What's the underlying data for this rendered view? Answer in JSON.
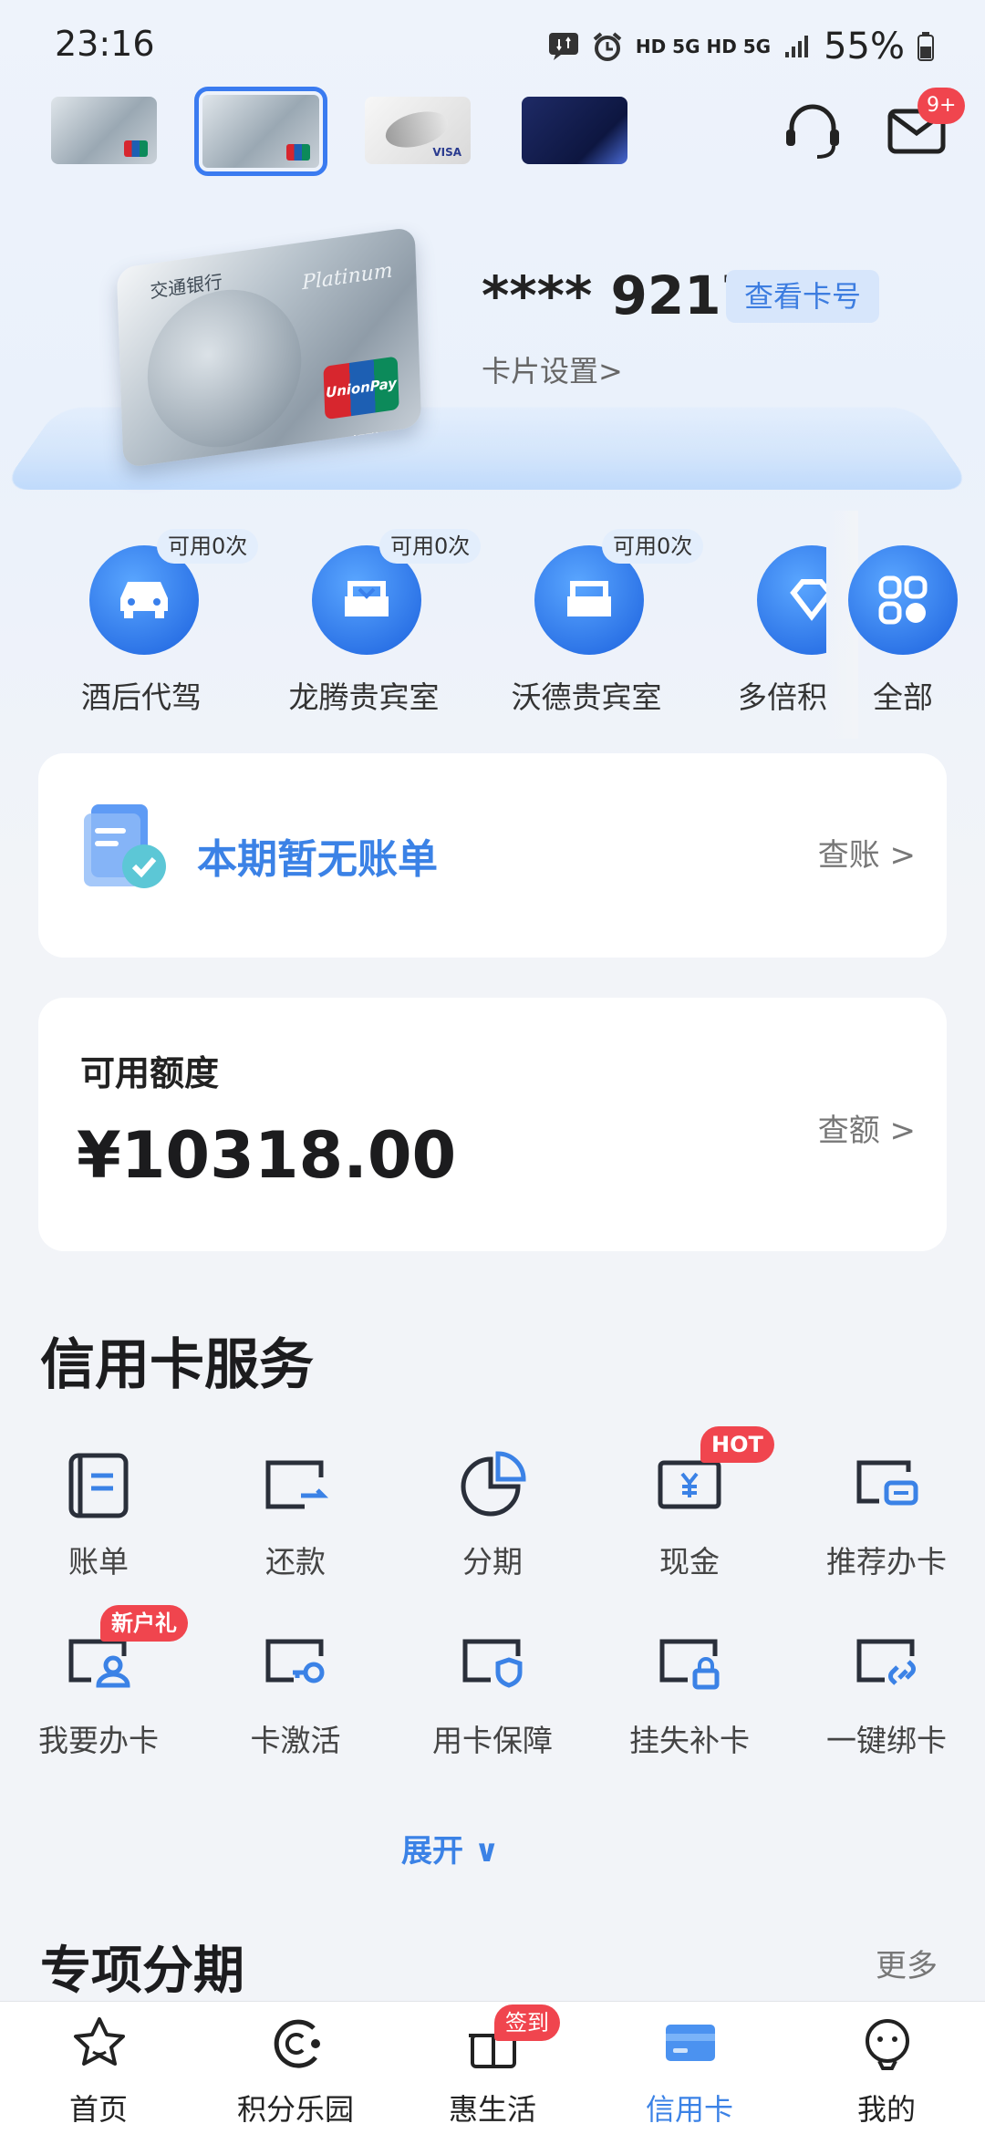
{
  "status_bar": {
    "time": "23:16",
    "network": "HD 5G HD 5G",
    "battery": "55%"
  },
  "header": {
    "message_badge": "9+",
    "icons": [
      "customer-service-icon",
      "mail-icon"
    ]
  },
  "card": {
    "thumbnails": [
      "silver-unionpay",
      "silver-unionpay-selected",
      "white-visa",
      "dark-blue"
    ],
    "number_masked": "**** 9217",
    "view_number_button": "查看卡号",
    "settings_link": "卡片设置>",
    "card_face_text": "Platinum",
    "card_bank_text": "交通银行",
    "card_brand_text": "UnionPay 银联"
  },
  "benefits": {
    "items": [
      {
        "label": "酒后代驾",
        "tag": "可用0次"
      },
      {
        "label": "龙腾贵宾室",
        "tag": "可用0次"
      },
      {
        "label": "沃德贵宾室",
        "tag": "可用0次"
      },
      {
        "label": "多倍积"
      }
    ],
    "all_label": "全部"
  },
  "bill": {
    "text": "本期暂无账单",
    "link": "查账 >"
  },
  "credit": {
    "label": "可用额度",
    "amount": "¥10318.00",
    "link": "查额 >"
  },
  "services": {
    "title": "信用卡服务",
    "items": [
      {
        "label": "账单",
        "icon": "bill-icon"
      },
      {
        "label": "还款",
        "icon": "repay-icon"
      },
      {
        "label": "分期",
        "icon": "installment-icon"
      },
      {
        "label": "现金",
        "icon": "cash-icon",
        "badge": "HOT"
      },
      {
        "label": "推荐办卡",
        "icon": "recommend-card-icon"
      },
      {
        "label": "我要办卡",
        "icon": "apply-card-icon",
        "badge": "新户礼"
      },
      {
        "label": "卡激活",
        "icon": "activate-card-icon"
      },
      {
        "label": "用卡保障",
        "icon": "card-protection-icon"
      },
      {
        "label": "挂失补卡",
        "icon": "lost-card-icon"
      },
      {
        "label": "一键绑卡",
        "icon": "bind-card-icon"
      }
    ],
    "expand_label": "展开 ∨"
  },
  "special_installment": {
    "title": "专项分期",
    "more": "更多"
  },
  "tabbar": {
    "items": [
      {
        "label": "首页",
        "icon": "star-icon"
      },
      {
        "label": "积分乐园",
        "icon": "points-icon"
      },
      {
        "label": "惠生活",
        "icon": "gift-icon",
        "badge": "签到"
      },
      {
        "label": "信用卡",
        "icon": "credit-card-icon",
        "active": true
      },
      {
        "label": "我的",
        "icon": "profile-icon"
      }
    ]
  },
  "colors": {
    "accent": "#3b82e6",
    "badge_red": "#f0454e",
    "background": "#f2f4f8"
  }
}
